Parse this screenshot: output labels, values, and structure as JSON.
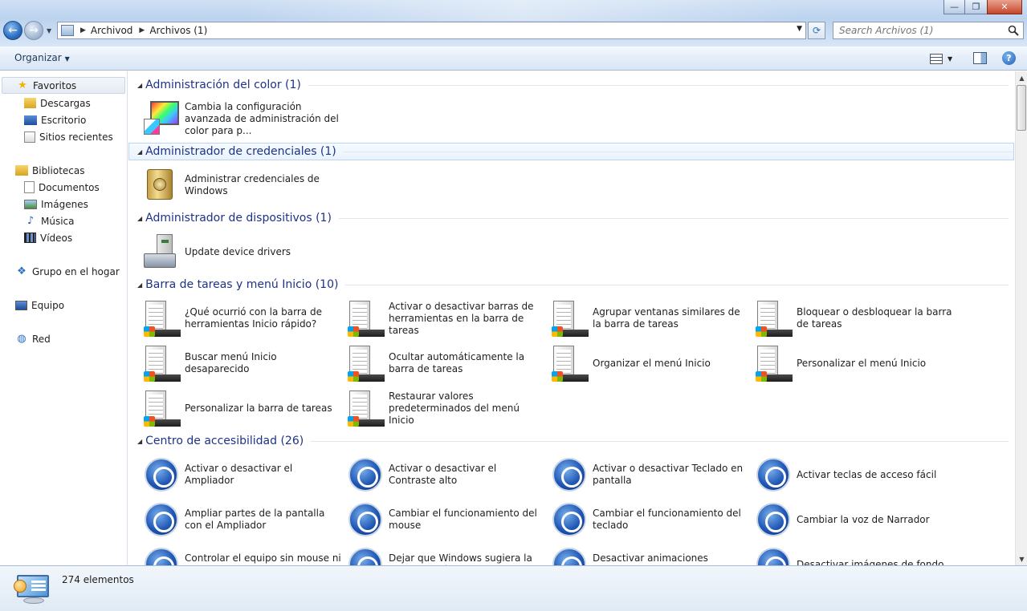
{
  "window": {
    "controls": {
      "minimize": "—",
      "maximize": "❐",
      "close": "✕"
    }
  },
  "nav": {
    "back": "←",
    "forward": "→",
    "history": "▼"
  },
  "address": {
    "breadcrumbs": [
      "Archivod",
      "Archivos (1)"
    ],
    "dropdown": "▼",
    "refresh": "⟳"
  },
  "search": {
    "placeholder": "Search Archivos (1)"
  },
  "toolbar": {
    "organize_label": "Organizar",
    "organize_arrow": "▼",
    "views_arrow": "▼",
    "help": "?"
  },
  "sidebar": {
    "favorites": {
      "label": "Favoritos",
      "icon": "star-icon"
    },
    "favorites_items": [
      {
        "label": "Descargas",
        "icon": "downloads-folder-icon"
      },
      {
        "label": "Escritorio",
        "icon": "desktop-icon"
      },
      {
        "label": "Sitios recientes",
        "icon": "recent-places-icon"
      }
    ],
    "libraries": {
      "label": "Bibliotecas",
      "icon": "libraries-icon"
    },
    "libraries_items": [
      {
        "label": "Documentos",
        "icon": "documents-icon"
      },
      {
        "label": "Imágenes",
        "icon": "pictures-icon"
      },
      {
        "label": "Música",
        "icon": "music-icon"
      },
      {
        "label": "Vídeos",
        "icon": "videos-icon"
      }
    ],
    "homegroup": {
      "label": "Grupo en el hogar",
      "icon": "homegroup-icon"
    },
    "computer": {
      "label": "Equipo",
      "icon": "computer-icon"
    },
    "network": {
      "label": "Red",
      "icon": "network-icon"
    }
  },
  "groups": [
    {
      "title": "Administración del color (1)",
      "items": [
        {
          "label": "Cambia la configuración avanzada de administración del color para p...",
          "icon": "color-management-icon"
        }
      ]
    },
    {
      "title": "Administrador de credenciales (1)",
      "items": [
        {
          "label": "Administrar credenciales de Windows",
          "icon": "credential-safe-icon"
        }
      ]
    },
    {
      "title": "Administrador de dispositivos (1)",
      "items": [
        {
          "label": "Update device drivers",
          "icon": "device-manager-icon"
        }
      ]
    },
    {
      "title": "Barra de tareas y menú Inicio (10)",
      "items": [
        {
          "label": "¿Qué ocurrió con la barra de herramientas Inicio rápido?",
          "icon": "taskbar-icon"
        },
        {
          "label": "Activar o desactivar barras de herramientas en la barra de tareas",
          "icon": "taskbar-icon"
        },
        {
          "label": "Agrupar ventanas similares de la barra de tareas",
          "icon": "taskbar-icon"
        },
        {
          "label": "Bloquear o desbloquear la barra de tareas",
          "icon": "taskbar-icon"
        },
        {
          "label": "Buscar menú Inicio desaparecido",
          "icon": "taskbar-icon"
        },
        {
          "label": "Ocultar automáticamente la barra de tareas",
          "icon": "taskbar-icon"
        },
        {
          "label": "Organizar el menú Inicio",
          "icon": "taskbar-icon"
        },
        {
          "label": "Personalizar el menú Inicio",
          "icon": "taskbar-icon"
        },
        {
          "label": "Personalizar la barra de tareas",
          "icon": "taskbar-icon"
        },
        {
          "label": "Restaurar valores predeterminados del menú Inicio",
          "icon": "taskbar-icon"
        }
      ]
    },
    {
      "title": "Centro de accesibilidad (26)",
      "items": [
        {
          "label": "Activar o desactivar el Ampliador",
          "icon": "accessibility-icon"
        },
        {
          "label": "Activar o desactivar el Contraste alto",
          "icon": "accessibility-icon"
        },
        {
          "label": "Activar o desactivar Teclado en pantalla",
          "icon": "accessibility-icon"
        },
        {
          "label": "Activar teclas de acceso fácil",
          "icon": "accessibility-icon"
        },
        {
          "label": "Ampliar partes de la pantalla con el Ampliador",
          "icon": "accessibility-icon"
        },
        {
          "label": "Cambiar el funcionamiento del mouse",
          "icon": "accessibility-icon"
        },
        {
          "label": "Cambiar el funcionamiento del teclado",
          "icon": "accessibility-icon"
        },
        {
          "label": "Cambiar la voz de Narrador",
          "icon": "accessibility-icon"
        },
        {
          "label": "Controlar el equipo sin mouse ni teclado",
          "icon": "accessibility-icon"
        },
        {
          "label": "Dejar que Windows sugiera la configuración de accesibilidad",
          "icon": "accessibility-icon"
        },
        {
          "label": "Desactivar animaciones innecesarias",
          "icon": "accessibility-icon"
        },
        {
          "label": "Desactivar imágenes de fondo",
          "icon": "accessibility-icon"
        }
      ]
    }
  ],
  "status": {
    "item_count": "274 elementos"
  }
}
